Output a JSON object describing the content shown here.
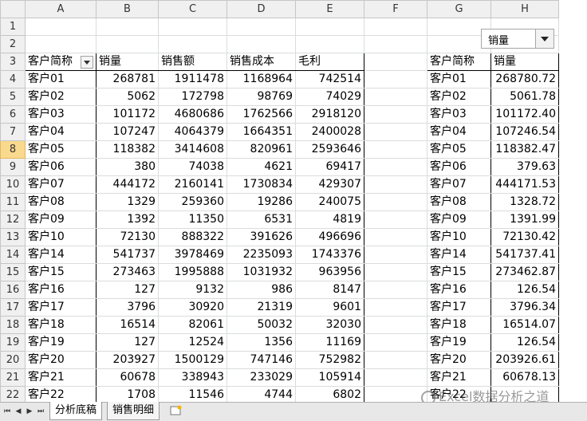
{
  "columns": [
    "A",
    "B",
    "C",
    "D",
    "E",
    "F",
    "G",
    "H"
  ],
  "row_numbers": [
    "1",
    "2",
    "3",
    "4",
    "5",
    "6",
    "7",
    "8",
    "9",
    "10",
    "11",
    "12",
    "13",
    "14",
    "15",
    "16",
    "17",
    "18",
    "19",
    "20",
    "21",
    "22"
  ],
  "selected_row": "8",
  "dropdown": {
    "value": "销量"
  },
  "left_table": {
    "headers": [
      "客户简称",
      "销量",
      "销售额",
      "销售成本",
      "毛利"
    ],
    "rows": [
      [
        "客户01",
        "268781",
        "1911478",
        "1168964",
        "742514"
      ],
      [
        "客户02",
        "5062",
        "172798",
        "98769",
        "74029"
      ],
      [
        "客户03",
        "101172",
        "4680686",
        "1762566",
        "2918120"
      ],
      [
        "客户04",
        "107247",
        "4064379",
        "1664351",
        "2400028"
      ],
      [
        "客户05",
        "118382",
        "3414608",
        "820961",
        "2593646"
      ],
      [
        "客户06",
        "380",
        "74038",
        "4621",
        "69417"
      ],
      [
        "客户07",
        "444172",
        "2160141",
        "1730834",
        "429307"
      ],
      [
        "客户08",
        "1329",
        "259360",
        "19286",
        "240075"
      ],
      [
        "客户09",
        "1392",
        "11350",
        "6531",
        "4819"
      ],
      [
        "客户10",
        "72130",
        "888322",
        "391626",
        "496696"
      ],
      [
        "客户14",
        "541737",
        "3978469",
        "2235093",
        "1743376"
      ],
      [
        "客户15",
        "273463",
        "1995888",
        "1031932",
        "963956"
      ],
      [
        "客户16",
        "127",
        "9132",
        "986",
        "8147"
      ],
      [
        "客户17",
        "3796",
        "30920",
        "21319",
        "9601"
      ],
      [
        "客户18",
        "16514",
        "82061",
        "50032",
        "32030"
      ],
      [
        "客户19",
        "127",
        "12524",
        "1356",
        "11169"
      ],
      [
        "客户20",
        "203927",
        "1500129",
        "747146",
        "752982"
      ],
      [
        "客户21",
        "60678",
        "338943",
        "233029",
        "105914"
      ],
      [
        "客户22",
        "1708",
        "11546",
        "4744",
        "6802"
      ]
    ]
  },
  "right_table": {
    "headers": [
      "客户简称",
      "销量"
    ],
    "rows": [
      [
        "客户01",
        "268780.72"
      ],
      [
        "客户02",
        "5061.78"
      ],
      [
        "客户03",
        "101172.40"
      ],
      [
        "客户04",
        "107246.54"
      ],
      [
        "客户05",
        "118382.47"
      ],
      [
        "客户06",
        "379.63"
      ],
      [
        "客户07",
        "444171.53"
      ],
      [
        "客户08",
        "1328.72"
      ],
      [
        "客户09",
        "1391.99"
      ],
      [
        "客户10",
        "72130.42"
      ],
      [
        "客户14",
        "541737.41"
      ],
      [
        "客户15",
        "273462.87"
      ],
      [
        "客户16",
        "126.54"
      ],
      [
        "客户17",
        "3796.34"
      ],
      [
        "客户18",
        "16514.07"
      ],
      [
        "客户19",
        "126.54"
      ],
      [
        "客户20",
        "203926.61"
      ],
      [
        "客户21",
        "60678.13"
      ],
      [
        "客户22",
        ""
      ]
    ]
  },
  "sheet_tabs": [
    {
      "label": "分析底稿"
    },
    {
      "label": "销售明细"
    }
  ],
  "watermark": {
    "text": "Excel数据分析之道"
  }
}
